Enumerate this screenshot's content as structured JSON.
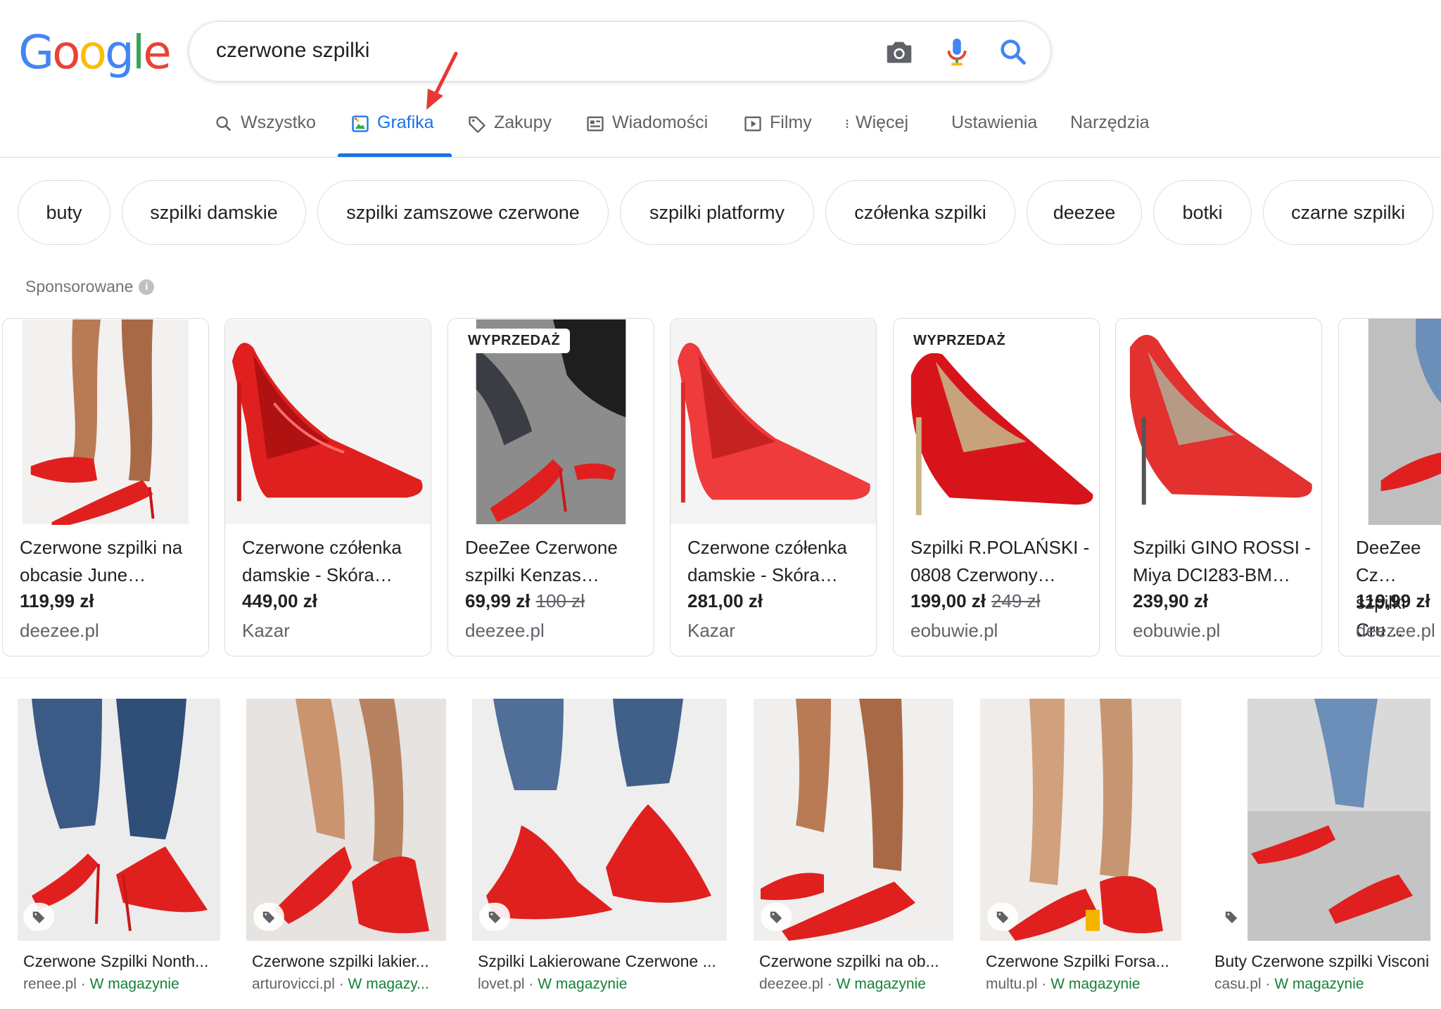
{
  "brand": {
    "logo_letters": [
      "G",
      "o",
      "o",
      "g",
      "l",
      "e"
    ],
    "logo_colors": [
      "#4285f4",
      "#ea4335",
      "#fbbc05",
      "#4285f4",
      "#34a853",
      "#ea4335"
    ]
  },
  "search": {
    "query": "czerwone szpilki",
    "camera_icon": "camera-icon",
    "mic_icon": "microphone-icon",
    "search_icon": "search-icon"
  },
  "tabs": [
    {
      "label": "Wszystko",
      "icon": "search-icon",
      "active": false
    },
    {
      "label": "Grafika",
      "icon": "image-icon",
      "active": true
    },
    {
      "label": "Zakupy",
      "icon": "tag-icon",
      "active": false
    },
    {
      "label": "Wiadomości",
      "icon": "news-icon",
      "active": false
    },
    {
      "label": "Filmy",
      "icon": "play-icon",
      "active": false
    },
    {
      "label": "Więcej",
      "icon": "more-vert-icon",
      "active": false
    },
    {
      "label": "Ustawienia",
      "active": false
    },
    {
      "label": "Narzędzia",
      "active": false
    }
  ],
  "chips": [
    "buty",
    "szpilki damskie",
    "szpilki zamszowe czerwone",
    "szpilki platformy",
    "czółenka szpilki",
    "deezee",
    "botki",
    "czarne szpilki"
  ],
  "sponsored": {
    "label": "Sponsorowane"
  },
  "products": [
    {
      "title": "Czerwone szpilki na obcasie June…",
      "price": "119,99 zł",
      "old_price": "",
      "store": "deezee.pl",
      "badge": ""
    },
    {
      "title": "Czerwone czółenka damskie - Skóra…",
      "price": "449,00 zł",
      "old_price": "",
      "store": "Kazar",
      "badge": ""
    },
    {
      "title": "DeeZee Czerwone szpilki Kenzas…",
      "price": "69,99 zł",
      "old_price": "100 zł",
      "store": "deezee.pl",
      "badge": "WYPRZEDAŻ"
    },
    {
      "title": "Czerwone czółenka damskie - Skóra…",
      "price": "281,00 zł",
      "old_price": "",
      "store": "Kazar",
      "badge": ""
    },
    {
      "title": "Szpilki R.POLAŃSKI - 0808 Czerwony…",
      "price": "199,00 zł",
      "old_price": "249 zł",
      "store": "eobuwie.pl",
      "badge": "WYPRZEDAŻ"
    },
    {
      "title": "Szpilki GINO ROSSI - Miya DCI283-BM…",
      "price": "239,90 zł",
      "old_price": "",
      "store": "eobuwie.pl",
      "badge": ""
    },
    {
      "title": "DeeZee Cz… szpilki Cru…",
      "price": "119,99 zł",
      "old_price": "",
      "store": "deezee.pl",
      "badge": ""
    }
  ],
  "images": [
    {
      "title": "Czerwone Szpilki Nonth...",
      "source": "renee.pl",
      "stock": "W magazynie"
    },
    {
      "title": "Czerwone szpilki lakier...",
      "source": "arturovicci.pl",
      "stock": "W magazy..."
    },
    {
      "title": "Szpilki Lakierowane Czerwone ...",
      "source": "lovet.pl",
      "stock": "W magazynie"
    },
    {
      "title": "Czerwone szpilki na ob...",
      "source": "deezee.pl",
      "stock": "W magazynie"
    },
    {
      "title": "Czerwone Szpilki Forsa...",
      "source": "multu.pl",
      "stock": "W magazynie"
    },
    {
      "title": "Buty Czerwone szpilki Visconi",
      "source": "casu.pl",
      "stock": "W magazynie"
    }
  ],
  "colors": {
    "accent": "#1a73e8",
    "in_stock": "#188038",
    "shoe_red": "#e0201e",
    "annotation_arrow": "#e53935"
  }
}
